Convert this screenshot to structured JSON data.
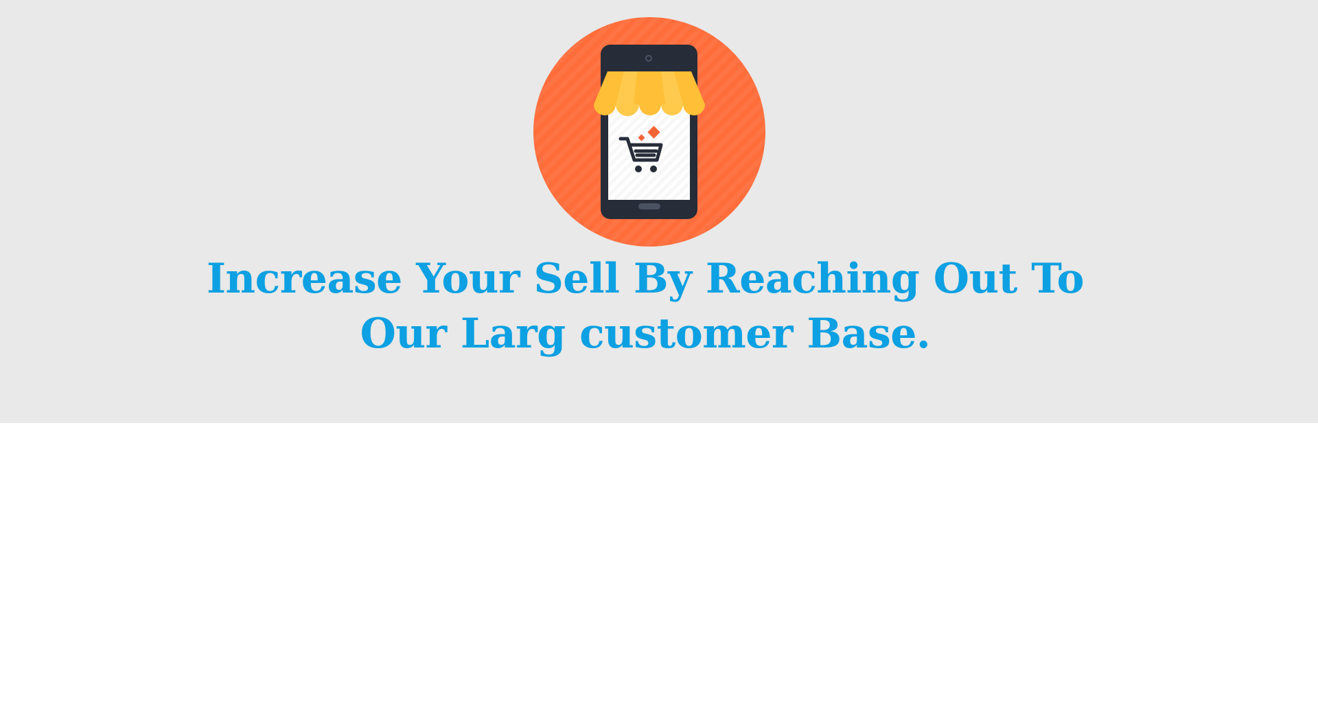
{
  "hero": {
    "background": "#e8e9e8",
    "icon_name": "mobile-shop-icon",
    "headline": "Increase Your Sell By Reaching Out To Our Larg customer Base.",
    "headline_color": "#0da0e2"
  },
  "colors": {
    "circle": "#ff6d3b",
    "phone_body": "#262c38",
    "awning_yellow": "#ffbf36",
    "awning_light": "#ffd25e",
    "screen": "#ffffff",
    "cart": "#262c38",
    "accent_orange": "#f26336"
  }
}
